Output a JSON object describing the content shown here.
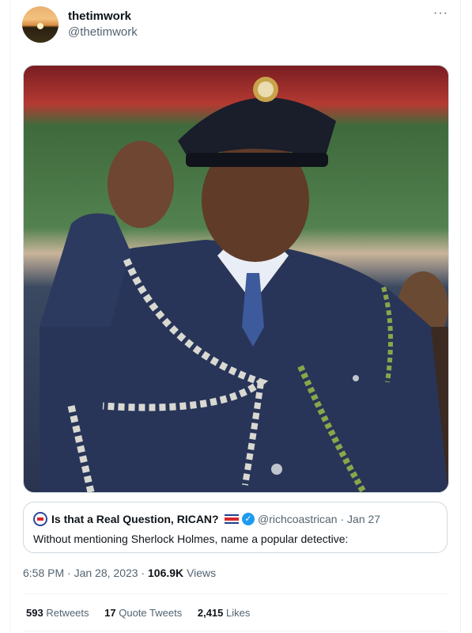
{
  "tweet": {
    "display_name": "thetimwork",
    "handle": "@thetimwork",
    "more_icon": "more-horizontal-icon"
  },
  "quoted": {
    "name": "Is that a Real Question, RICAN?",
    "handle": "@richcoastrican",
    "date": "Jan 27",
    "separator": "·",
    "text": "Without mentioning Sherlock Holmes, name a popular detective:",
    "verified_color": "#1d9bf0"
  },
  "meta": {
    "time": "6:58 PM",
    "date": "Jan 28, 2023",
    "dot": "·",
    "views_count": "106.9K",
    "views_label": "Views"
  },
  "stats": {
    "retweets_count": "593",
    "retweets_label": "Retweets",
    "quotes_count": "17",
    "quotes_label": "Quote Tweets",
    "likes_count": "2,415",
    "likes_label": "Likes"
  }
}
